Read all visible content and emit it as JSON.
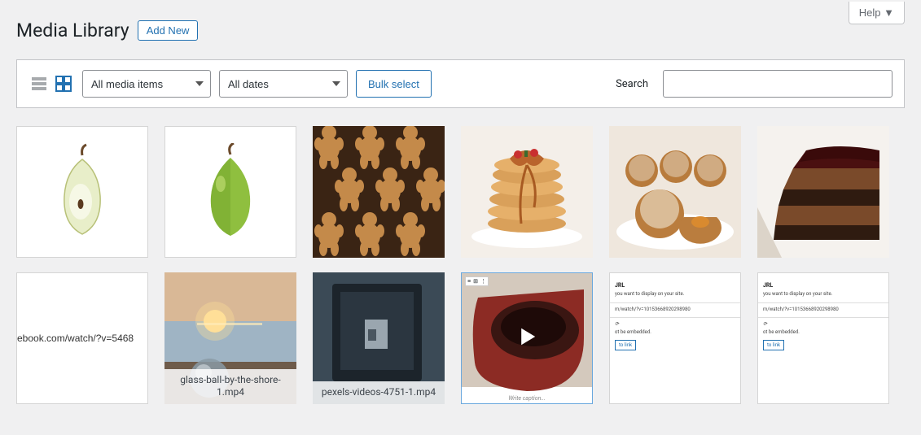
{
  "help": {
    "label": "Help ▼"
  },
  "header": {
    "title": "Media Library",
    "add_new_label": "Add New"
  },
  "toolbar": {
    "media_type_selected": "All media items",
    "date_selected": "All dates",
    "bulk_select_label": "Bulk select",
    "search_label": "Search",
    "search_placeholder": ""
  },
  "media": {
    "items": [
      {
        "name": "pear-cut",
        "kind": "image",
        "thumb": "pear-half",
        "bordered": true
      },
      {
        "name": "pear-whole",
        "kind": "image",
        "thumb": "pear-whole",
        "bordered": true
      },
      {
        "name": "gingerbread",
        "kind": "image",
        "thumb": "gingerbread"
      },
      {
        "name": "pancakes",
        "kind": "image",
        "thumb": "pancakes"
      },
      {
        "name": "donuts",
        "kind": "image",
        "thumb": "donuts"
      },
      {
        "name": "choco-cake",
        "kind": "image",
        "thumb": "cake"
      },
      {
        "name": "fb-link",
        "kind": "image",
        "thumb": "fb-link",
        "bordered": true,
        "link_text": "ebook.com/watch/?v=5468"
      },
      {
        "name": "glass-ball",
        "kind": "video-file",
        "thumb": "sunset",
        "caption": "glass-ball-by-the-shore-1.mp4"
      },
      {
        "name": "pexels-4751",
        "kind": "video-file",
        "thumb": "monitor",
        "caption": "pexels-videos-4751-1.mp4"
      },
      {
        "name": "coffee-video",
        "kind": "video-embed",
        "thumb": "coffee"
      },
      {
        "name": "embed-error-1",
        "kind": "image",
        "thumb": "embed-error",
        "bordered": true
      },
      {
        "name": "embed-error-2",
        "kind": "image",
        "thumb": "embed-error",
        "bordered": true
      }
    ]
  },
  "embed_card": {
    "title_fragment": "JRL",
    "line1": "you want to display on your site.",
    "url_line": "m/watch/?v=10153668920298980",
    "line2": "ot be embedded.",
    "link_label": "to link"
  },
  "coffee_caption": "Write caption..."
}
